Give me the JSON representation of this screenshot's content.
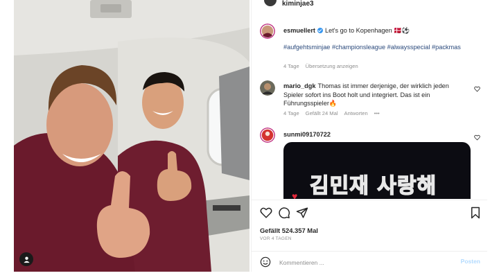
{
  "header": {
    "username": "kiminjae3"
  },
  "caption": {
    "username": "esmuellert",
    "text": "Let's go to Kopenhagen 🇩🇰⚽",
    "hashtags": "#aufgehtsminjae #championsleague #alwaysspecial #packmas",
    "age": "4 Tage",
    "translate": "Übersetzung anzeigen"
  },
  "comments": [
    {
      "username": "mario_dgk",
      "text": "Thomas ist immer derjenige, der wirklich jeden Spieler sofort ins Boot holt und integriert. Das ist ein Führungsspieler🔥",
      "age": "4 Tage",
      "likes": "Gefällt 24 Mal",
      "reply": "Antworten",
      "more": "•••"
    },
    {
      "username": "sunmi09170722",
      "media_text": "김민재 사랑해"
    }
  ],
  "likes_count": "Gefällt 524.357 Mal",
  "post_date": "VOR 4 TAGEN",
  "comment_box": {
    "placeholder": "Kommentieren ...",
    "post_label": "Posten"
  },
  "icons": {
    "like": "heart-icon",
    "comment": "comment-icon",
    "share": "share-icon",
    "save": "bookmark-icon",
    "emoji": "emoji-icon",
    "tag": "user-tag-icon",
    "verified": "verified-badge-icon"
  },
  "colors": {
    "link_blue": "#2b4a7c",
    "verified": "#3897f0",
    "muted": "#8e8e8e",
    "post_disabled": "#b3dbff"
  }
}
